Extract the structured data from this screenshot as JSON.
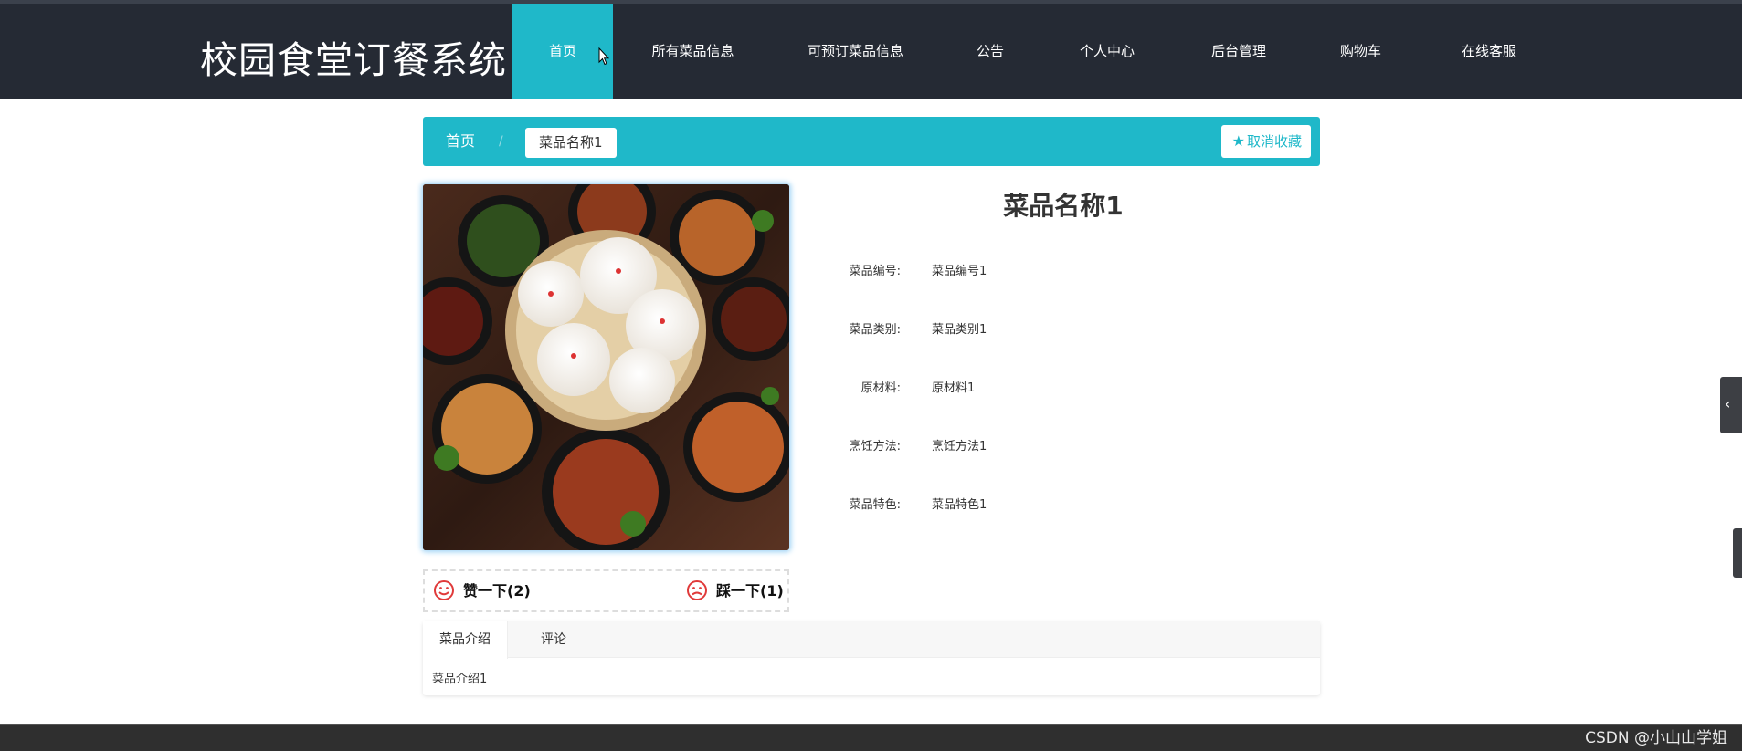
{
  "header": {
    "site_title": "校园食堂订餐系统",
    "nav": [
      {
        "label": "首页",
        "active": true
      },
      {
        "label": "所有菜品信息"
      },
      {
        "label": "可预订菜品信息"
      },
      {
        "label": "公告"
      },
      {
        "label": "个人中心"
      },
      {
        "label": "后台管理"
      },
      {
        "label": "购物车"
      },
      {
        "label": "在线客服"
      }
    ]
  },
  "breadcrumb": {
    "home": "首页",
    "separator": "/",
    "current": "菜品名称1",
    "favorite_button": "取消收藏",
    "favorite_icon": "star-icon"
  },
  "product": {
    "image_icon": "food-photo",
    "name": "菜品名称1",
    "fields": [
      {
        "label": "菜品编号:",
        "value": "菜品编号1"
      },
      {
        "label": "菜品类别:",
        "value": "菜品类别1"
      },
      {
        "label": "原材料:",
        "value": "原材料1"
      },
      {
        "label": "烹饪方法:",
        "value": "烹饪方法1"
      },
      {
        "label": "菜品特色:",
        "value": "菜品特色1"
      }
    ],
    "like_label": "赞一下(2)",
    "dislike_label": "踩一下(1)",
    "like_icon": "smile-icon",
    "dislike_icon": "frown-icon"
  },
  "tabs": {
    "items": [
      {
        "label": "菜品介绍",
        "active": true
      },
      {
        "label": "评论"
      }
    ],
    "content": "菜品介绍1"
  },
  "footer": {
    "watermark": "CSDN @小山山学姐"
  },
  "colors": {
    "accent": "#1fb8c9",
    "nav_bg": "#252a34",
    "vote_icon": "#e03a3a"
  }
}
